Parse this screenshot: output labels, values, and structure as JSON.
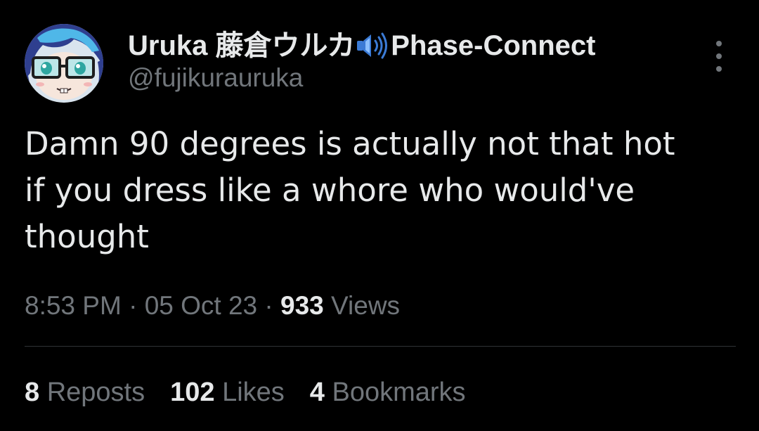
{
  "author": {
    "display_name": "Uruka 藤倉ウルカ",
    "display_name_suffix": "Phase-Connect",
    "handle": "@fujikurauruka",
    "avatar_icon": "avatar-anime-character-with-glasses",
    "name_emoji": "speaker-high-volume-icon"
  },
  "tweet": {
    "text": "Damn 90 degrees is actually not that hot\nif you dress like a whore who would've\nthought"
  },
  "meta": {
    "time": "8:53 PM",
    "sep1": " · ",
    "date": "05 Oct 23",
    "sep2": " · ",
    "views_count": "933",
    "views_label": " Views"
  },
  "stats": {
    "reposts_count": "8",
    "reposts_label": " Reposts",
    "likes_count": "102",
    "likes_label": " Likes",
    "bookmarks_count": "4",
    "bookmarks_label": " Bookmarks"
  },
  "colors": {
    "background": "#000000",
    "primary_text": "#e7e9ea",
    "secondary_text": "#71767b",
    "divider": "#2f3336",
    "speaker_blue": "#3b7bd6"
  }
}
